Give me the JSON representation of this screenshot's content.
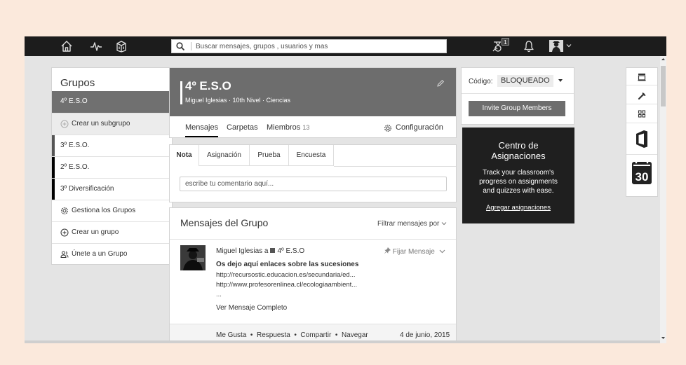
{
  "topbar": {
    "search_placeholder": "Buscar mensajes, grupos , usuarios y mas",
    "notification_count": "1"
  },
  "sidebar": {
    "title": "Grupos",
    "items": [
      {
        "label": "4º E.S.O"
      },
      {
        "label": "Crear un subgrupo"
      },
      {
        "label": "3º E.S.O."
      },
      {
        "label": "2º E.S.O."
      },
      {
        "label": "3º Diversificación"
      },
      {
        "label": "Gestiona los Grupos"
      },
      {
        "label": "Crear un grupo"
      },
      {
        "label": "Únete a un Grupo"
      }
    ]
  },
  "group": {
    "name": "4º E.S.O",
    "subtitle": "Miguel Iglesias · 10th Nivel · Ciencias",
    "tabs": [
      {
        "label": "Mensajes"
      },
      {
        "label": "Carpetas"
      },
      {
        "label": "Miembros",
        "count": "13"
      }
    ],
    "config_label": "Configuración"
  },
  "composer": {
    "tabs": [
      "Nota",
      "Asignación",
      "Prueba",
      "Encuesta"
    ],
    "placeholder": "escribe tu comentario aquí..."
  },
  "feed": {
    "title": "Mensajes del Grupo",
    "filter_label": "Filtrar mensajes por",
    "post": {
      "author": "Miguel Iglesias a",
      "group": "4º E.S.O",
      "pin_label": "Fijar Mensaje",
      "lines": [
        "Os dejo aquí enlaces sobre las sucesiones",
        "http://recursostic.educacion.es/secundaria/ed...",
        "http://www.profesorenlinea.cl/ecologiaambient...",
        "..."
      ],
      "more_label": "Ver Mensaje Completo",
      "actions": {
        "like": "Me Gusta",
        "reply": "Respuesta",
        "share": "Compartir",
        "navigate": "Navegar"
      },
      "date": "4 de junio, 2015"
    }
  },
  "code": {
    "label": "Código:",
    "value": "BLOQUEADO",
    "invite_label": "Invite Group Members"
  },
  "promo": {
    "title_line1": "Centro de",
    "title_line2": "Asignaciones",
    "text_line1": "Track your classroom's",
    "text_line2": "progress on assignments",
    "text_line3": "and quizzes with ease.",
    "link_label": "Agregar asignaciones"
  },
  "apps": {
    "calendar_day": "30"
  }
}
